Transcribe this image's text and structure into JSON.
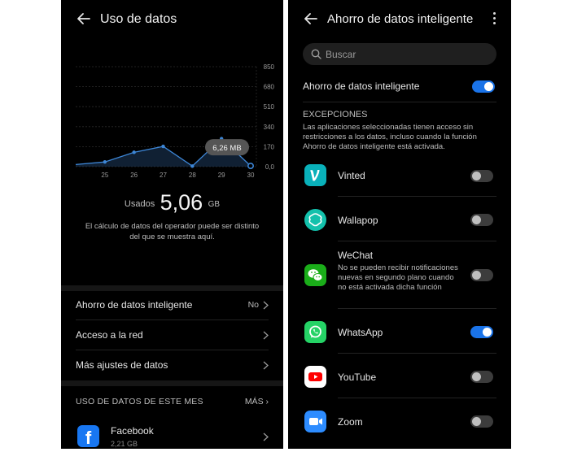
{
  "left_screen": {
    "title": "Uso de datos",
    "chart_data": {
      "type": "line",
      "x": [
        "24",
        "25",
        "26",
        "27",
        "28",
        "29",
        "30"
      ],
      "x_tick_labels": [
        "25",
        "26",
        "27",
        "28",
        "29",
        "30"
      ],
      "y_tick_labels": [
        "850",
        "680",
        "510",
        "340",
        "170",
        "0,0"
      ],
      "ylim": [
        0,
        850
      ],
      "values": [
        18,
        40,
        122,
        172,
        5,
        238,
        6.26
      ],
      "tooltip": "6,26 MB",
      "line_color": "#3d86d6"
    },
    "usage": {
      "label": "Usados",
      "value": "5,06",
      "unit": "GB"
    },
    "note": "El cálculo de datos del operador puede ser distinto del que se muestra aquí.",
    "menu": [
      {
        "label": "Ahorro de datos inteligente",
        "value": "No"
      },
      {
        "label": "Acceso a la red",
        "value": ""
      },
      {
        "label": "Más ajustes de datos",
        "value": ""
      }
    ],
    "section_title": "USO DE DATOS DE ESTE MES",
    "section_more": "MÁS",
    "app": {
      "name": "Facebook",
      "usage": "2,21 GB"
    }
  },
  "right_screen": {
    "title": "Ahorro de datos inteligente",
    "search_placeholder": "Buscar",
    "smart_saver": {
      "label": "Ahorro de datos inteligente",
      "enabled": true
    },
    "exceptions_title": "EXCEPCIONES",
    "exceptions_desc": "Las aplicaciones seleccionadas tienen acceso sin restricciones a los datos, incluso cuando la función Ahorro de datos inteligente está activada.",
    "apps": [
      {
        "name": "Vinted",
        "desc": "",
        "enabled": false,
        "icon": "vinted-icon",
        "color": "#09b1ba"
      },
      {
        "name": "Wallapop",
        "desc": "",
        "enabled": false,
        "icon": "wallapop-icon",
        "color": "#13c1ac"
      },
      {
        "name": "WeChat",
        "desc": "No se pueden recibir notificaciones nuevas en segundo plano cuando no está activada dicha función",
        "enabled": false,
        "icon": "wechat-icon",
        "color": "#1aad19"
      },
      {
        "name": "WhatsApp",
        "desc": "",
        "enabled": true,
        "icon": "whatsapp-icon",
        "color": "#25d366"
      },
      {
        "name": "YouTube",
        "desc": "",
        "enabled": false,
        "icon": "youtube-icon",
        "color": "#ff0000"
      },
      {
        "name": "Zoom",
        "desc": "",
        "enabled": false,
        "icon": "zoom-icon",
        "color": "#2d8cff"
      }
    ]
  }
}
